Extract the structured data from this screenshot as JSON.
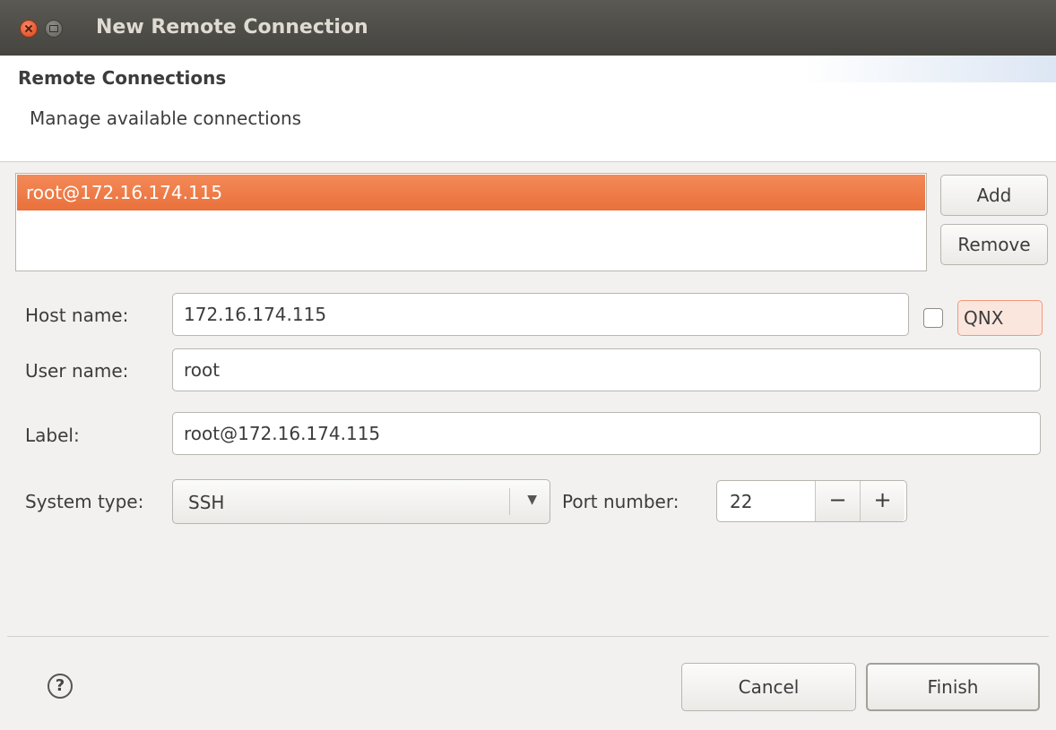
{
  "window": {
    "title": "New Remote Connection"
  },
  "header": {
    "title": "Remote Connections",
    "description": "Manage available connections"
  },
  "connections": [
    {
      "label": "root@172.16.174.115",
      "selected": true
    }
  ],
  "buttons": {
    "add": "Add",
    "remove": "Remove",
    "cancel": "Cancel",
    "finish": "Finish"
  },
  "form": {
    "host_label": "Host name:",
    "host_value": "172.16.174.115",
    "qnx_label": "QNX",
    "qnx_checked": false,
    "user_label": "User name:",
    "user_value": "root",
    "label_label": "Label:",
    "label_value": "root@172.16.174.115",
    "system_type_label": "System type:",
    "system_type_value": "SSH",
    "port_label": "Port number:",
    "port_value": "22",
    "minus": "−",
    "plus": "+"
  },
  "help": {
    "glyph": "?"
  },
  "colors": {
    "selection": "#e9703b",
    "titlebar": "#45443f",
    "qnx_highlight": "#fbe6de"
  }
}
